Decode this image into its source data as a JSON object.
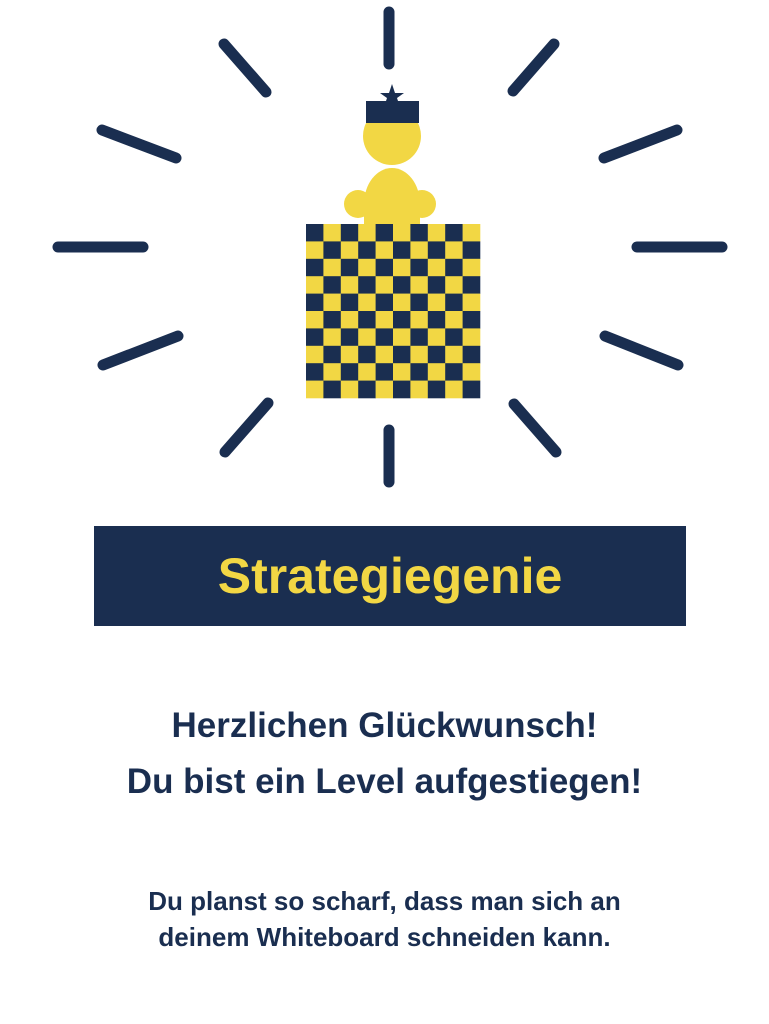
{
  "colors": {
    "navy": "#1a2e50",
    "yellow": "#f2d744",
    "background": "#ffffff"
  },
  "illustration": {
    "icon": "chess-king-on-checkerboard-icon",
    "rays_icon": "burst-rays-icon",
    "crown_icon": "star-crown-icon"
  },
  "badge": {
    "title": "Strategiegenie"
  },
  "message": {
    "headline_line1": "Herzlichen Glückwunsch!",
    "headline_line2": "Du bist ein Level aufgestiegen!",
    "body_line1": "Du planst so scharf, dass man sich an",
    "body_line2": "deinem Whiteboard schneiden kann."
  }
}
